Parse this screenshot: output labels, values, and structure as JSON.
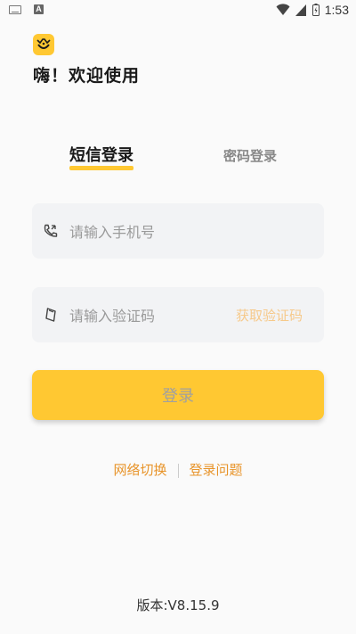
{
  "status_bar": {
    "time": "1:53",
    "notification_icons": [
      "keyboard-icon",
      "a-icon"
    ],
    "system_icons": [
      "wifi-icon",
      "signal-icon",
      "battery-icon"
    ]
  },
  "app": {
    "logo_icon": "smile-face-icon",
    "welcome": "嗨！欢迎使用"
  },
  "tabs": [
    {
      "label": "短信登录",
      "active": true
    },
    {
      "label": "密码登录",
      "active": false
    }
  ],
  "phone": {
    "placeholder": "请输入手机号",
    "icon": "phone-icon"
  },
  "code": {
    "placeholder": "请输入验证码",
    "icon": "shield-icon",
    "get_code_label": "获取验证码"
  },
  "login_button": {
    "label": "登录"
  },
  "links": {
    "network": "网络切换",
    "help": "登录问题"
  },
  "version": "版本:V8.15.9",
  "colors": {
    "accent": "#ffc832",
    "link": "#e8942a",
    "get_code": "#f6c98a",
    "background": "#fafafa"
  }
}
